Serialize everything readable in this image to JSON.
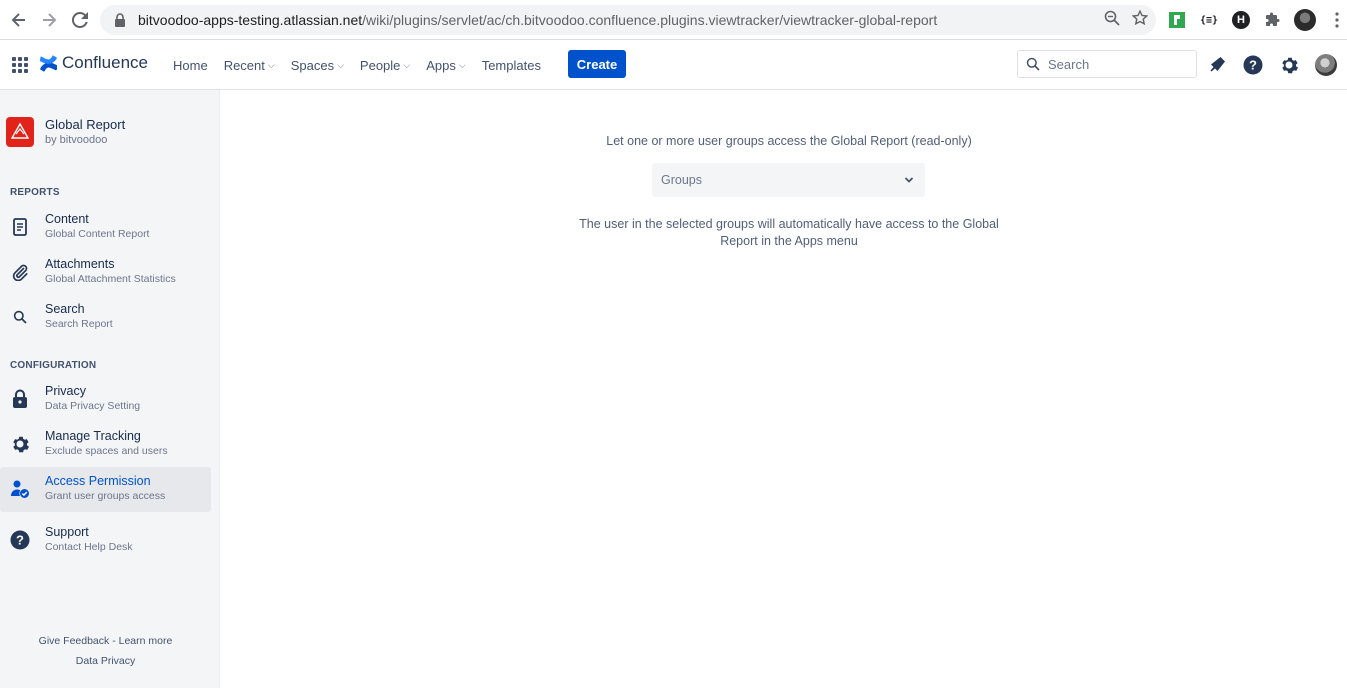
{
  "browser": {
    "url_host": "bitvoodoo-apps-testing.atlassian.net",
    "url_path": "/wiki/plugins/servlet/ac/ch.bitvoodoo.confluence.plugins.viewtracker/viewtracker-global-report",
    "ext_json_label": "{≡}",
    "ext_h_label": "H"
  },
  "header": {
    "brand": "Confluence",
    "nav": [
      {
        "label": "Home",
        "dropdown": false
      },
      {
        "label": "Recent",
        "dropdown": true
      },
      {
        "label": "Spaces",
        "dropdown": true
      },
      {
        "label": "People",
        "dropdown": true
      },
      {
        "label": "Apps",
        "dropdown": true
      },
      {
        "label": "Templates",
        "dropdown": false
      }
    ],
    "create_label": "Create",
    "search_placeholder": "Search",
    "accent": "#0052cc"
  },
  "sidebar": {
    "plugin_title": "Global Report",
    "plugin_by": "by bitvoodoo",
    "reports_label": "REPORTS",
    "configuration_label": "CONFIGURATION",
    "items": [
      {
        "title": "Content",
        "subtitle": "Global Content Report",
        "icon": "document-icon"
      },
      {
        "title": "Attachments",
        "subtitle": "Global Attachment Statistics",
        "icon": "paperclip-icon"
      },
      {
        "title": "Search",
        "subtitle": "Search Report",
        "icon": "search-icon"
      },
      {
        "title": "Privacy",
        "subtitle": "Data Privacy Setting",
        "icon": "lock-icon"
      },
      {
        "title": "Manage Tracking",
        "subtitle": "Exclude spaces and users",
        "icon": "gear-icon"
      },
      {
        "title": "Access Permission",
        "subtitle": "Grant user groups access",
        "icon": "user-check-icon",
        "active": true
      },
      {
        "title": "Support",
        "subtitle": "Contact Help Desk",
        "icon": "help-icon"
      }
    ],
    "footer": {
      "feedback": "Give Feedback",
      "separator": " - ",
      "learn_more": "Learn more",
      "data_privacy": "Data Privacy"
    }
  },
  "main": {
    "intro": "Let one or more user groups access the Global Report (read-only)",
    "groups_placeholder": "Groups",
    "note": "The user in the selected groups will automatically have access to the Global Report in the Apps menu"
  }
}
